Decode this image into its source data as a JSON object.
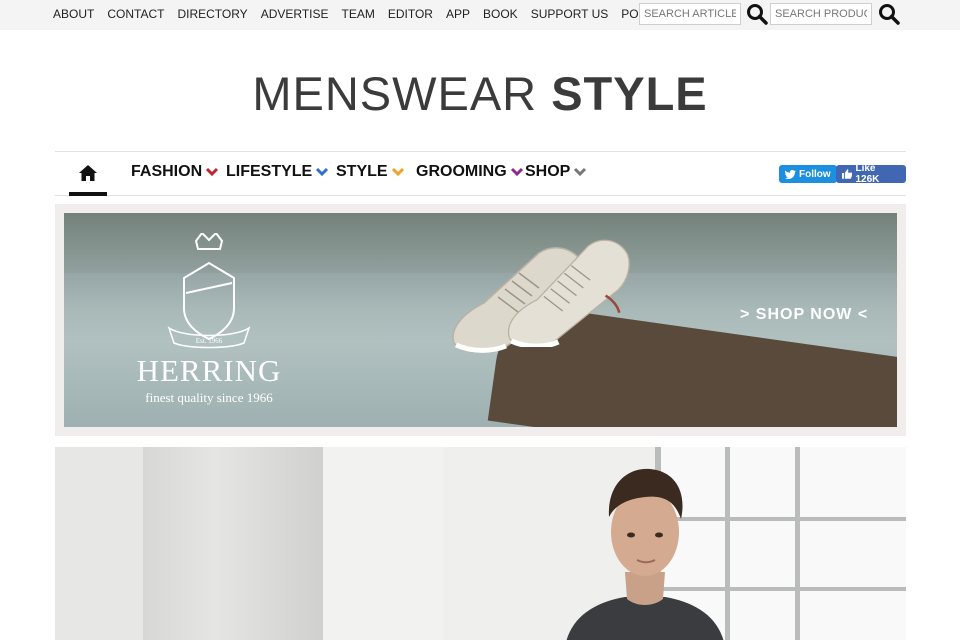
{
  "topbar": {
    "links": [
      "ABOUT",
      "CONTACT",
      "DIRECTORY",
      "ADVERTISE",
      "TEAM",
      "EDITOR",
      "APP",
      "BOOK",
      "SUPPORT US",
      "PODCASTS"
    ],
    "search_articles_placeholder": "SEARCH ARTICLES",
    "search_products_placeholder": "SEARCH PRODUCTS"
  },
  "logo": {
    "light": "MENSWEAR",
    "bold": "STYLE"
  },
  "nav": {
    "items": [
      {
        "label": "FASHION",
        "color": "#c0262d"
      },
      {
        "label": "LIFESTYLE",
        "color": "#2f6fd0"
      },
      {
        "label": "STYLE",
        "color": "#f0a12a"
      },
      {
        "label": "GROOMING",
        "color": "#8e2b8e"
      },
      {
        "label": "SHOP",
        "color": "#777777"
      }
    ],
    "twitter": "Follow",
    "facebook": "Like 126K"
  },
  "ad": {
    "brand": "HERRING",
    "tagline": "finest quality since 1966",
    "est": "Est. 1966",
    "cta": "> SHOP NOW <"
  }
}
